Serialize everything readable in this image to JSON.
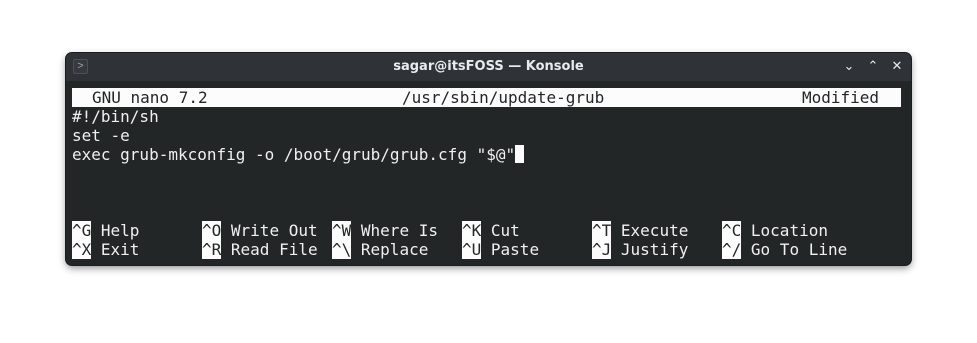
{
  "window": {
    "title": "sagar@itsFOSS — Konsole",
    "app_icon": ">",
    "controls": {
      "minimize": "⌄",
      "maximize": "⌃",
      "close": "✕"
    }
  },
  "nano": {
    "version_label": "GNU nano 7.2",
    "file_path": "/usr/sbin/update-grub",
    "status": "Modified",
    "lines": [
      "#!/bin/sh",
      "set -e",
      "exec grub-mkconfig -o /boot/grub/grub.cfg \"$@\""
    ],
    "shortcuts_row1": [
      {
        "key": "^G",
        "label": "Help"
      },
      {
        "key": "^O",
        "label": "Write Out"
      },
      {
        "key": "^W",
        "label": "Where Is"
      },
      {
        "key": "^K",
        "label": "Cut"
      },
      {
        "key": "^T",
        "label": "Execute"
      },
      {
        "key": "^C",
        "label": "Location"
      }
    ],
    "shortcuts_row2": [
      {
        "key": "^X",
        "label": "Exit"
      },
      {
        "key": "^R",
        "label": "Read File"
      },
      {
        "key": "^\\",
        "label": "Replace"
      },
      {
        "key": "^U",
        "label": "Paste"
      },
      {
        "key": "^J",
        "label": "Justify"
      },
      {
        "key": "^/",
        "label": "Go To Line"
      }
    ]
  }
}
